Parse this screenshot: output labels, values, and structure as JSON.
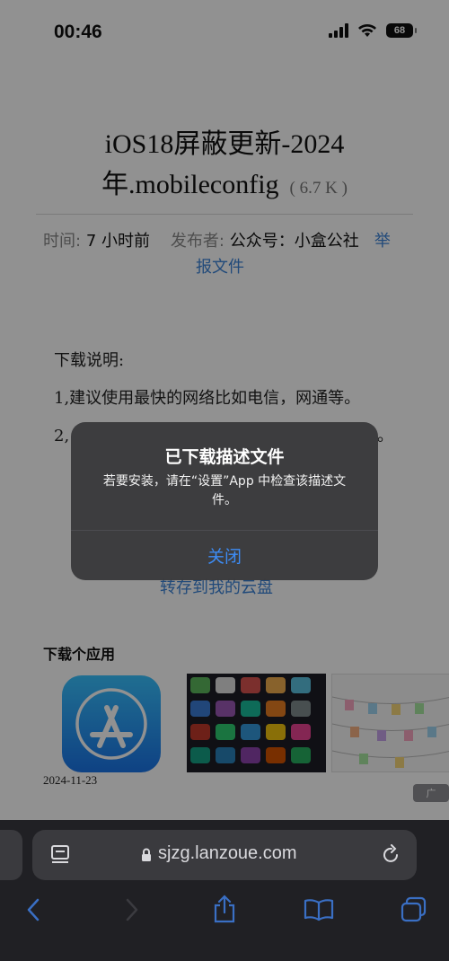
{
  "status_bar": {
    "time": "00:46",
    "battery": "68"
  },
  "page": {
    "title_line1": "iOS18屏蔽更新-2024",
    "title_line2": "年.mobileconfig",
    "file_size": "( 6.7 K )",
    "meta": {
      "time_label": "时间:",
      "time_value": "7 小时前",
      "publisher_label": "发布者:",
      "publisher_value": "公众号：小盒公社",
      "report_part1": "举",
      "report_part2": "报文件"
    },
    "download_notes": {
      "heading": "下载说明:",
      "line1": "1,建议使用最快的网络比如电信，网通等。",
      "line2_start": "2,",
      "line2_end": "。"
    },
    "save_to_cloud": "转存到我的云盘",
    "apps_title": "下载个应用",
    "app_date": "2024-11-23",
    "ad_badge": "广"
  },
  "alert": {
    "title": "已下载描述文件",
    "message": "若要安装，请在“设置”App 中检查该描述文件。",
    "close_button": "关闭"
  },
  "browser": {
    "url": "sjzg.lanzoue.com"
  },
  "colors": {
    "link": "#3b82d6",
    "alert_button": "#3d8cf5",
    "toolbar_icon": "#3a6fc4"
  },
  "icons": [
    "signal-icon",
    "wifi-icon",
    "battery-icon",
    "reader-icon",
    "lock-icon",
    "reload-icon",
    "back-icon",
    "forward-icon",
    "share-icon",
    "bookmarks-icon",
    "tabs-icon",
    "app-store-icon"
  ]
}
